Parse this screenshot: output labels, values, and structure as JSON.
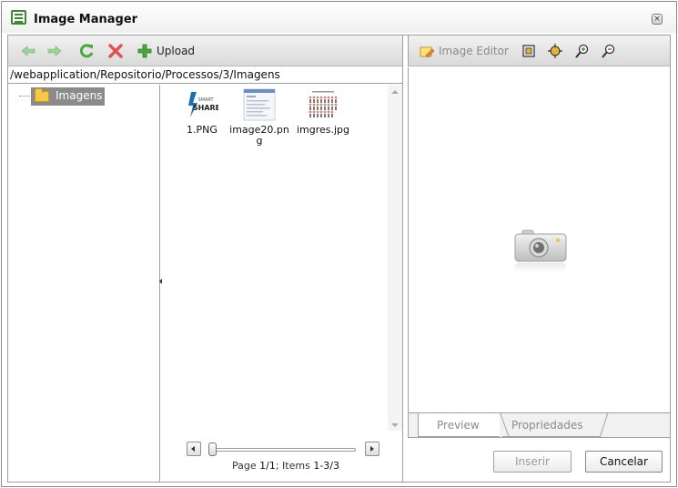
{
  "window": {
    "title": "Image Manager",
    "close_icon": "close-icon"
  },
  "toolbar": {
    "upload_label": "Upload",
    "icons": [
      "back-arrow-icon",
      "forward-arrow-icon",
      "refresh-icon",
      "delete-icon",
      "add-icon"
    ]
  },
  "path": "/webapplication/Repositorio/Processos/3/Imagens",
  "tree": {
    "root_label": "Imagens"
  },
  "files": [
    {
      "name": "1.PNG"
    },
    {
      "name": "image20.pn\ng"
    },
    {
      "name": "imgres.jpg"
    }
  ],
  "pager": {
    "prefix": "Page",
    "page": "1/1",
    "items_prefix": "; Items",
    "items": "1-3/3"
  },
  "editor": {
    "label": "Image Editor"
  },
  "tabs": {
    "preview": "Preview",
    "properties": "Propriedades"
  },
  "buttons": {
    "insert": "Inserir",
    "cancel": "Cancelar"
  },
  "colors": {
    "accent_green": "#3c8b2e",
    "folder": "#f5c84a",
    "selected_node": "#8b8b8b"
  }
}
